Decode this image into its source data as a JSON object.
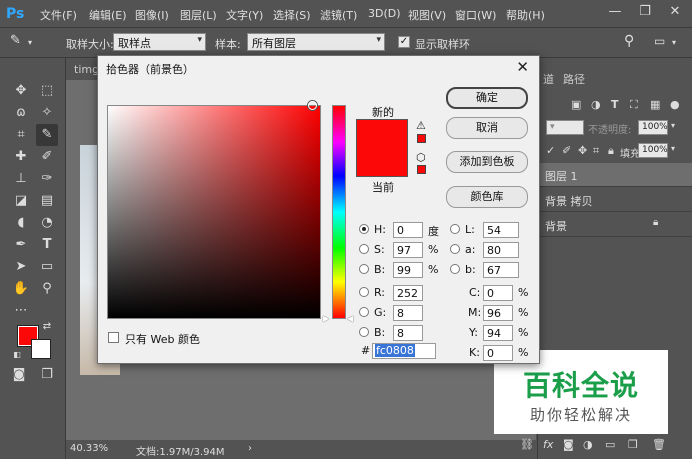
{
  "menubar": {
    "logo": "Ps",
    "items": [
      "文件(F)",
      "编辑(E)",
      "图像(I)",
      "图层(L)",
      "文字(Y)",
      "选择(S)",
      "滤镜(T)",
      "3D(D)",
      "视图(V)",
      "窗口(W)",
      "帮助(H)"
    ],
    "minimize": "—",
    "restore": "❐",
    "close": "✕"
  },
  "options": {
    "sample_size_label": "取样大小:",
    "sample_size_value": "取样点",
    "sample_label": "样本:",
    "sample_value": "所有图层",
    "show_ring_label": "显示取样环"
  },
  "document": {
    "tab_label": "timg",
    "zoom": "40.33%",
    "doc_info": "文档:1.97M/3.94M"
  },
  "right_panel": {
    "tab_channels": "道",
    "tab_paths": "路径",
    "opacity_label": "不透明度:",
    "opacity_value": "100%",
    "fill_label": "填充:",
    "fill_value": "100%",
    "layers": [
      {
        "name": "图层 1",
        "selected": true
      },
      {
        "name": "背景 拷贝",
        "selected": false
      },
      {
        "name": "背景",
        "selected": false
      }
    ]
  },
  "watermark": {
    "title": "百科全说",
    "subtitle": "助你轻松解决"
  },
  "dialog": {
    "title": "拾色器（前景色）",
    "close": "✕",
    "new_label": "新的",
    "current_label": "当前",
    "buttons": {
      "ok": "确定",
      "cancel": "取消",
      "add_swatch": "添加到色板",
      "libraries": "颜色库"
    },
    "web_only_label": "只有 Web 颜色",
    "hsb": {
      "h_label": "H:",
      "h_value": "0",
      "h_unit": "度",
      "s_label": "S:",
      "s_value": "97",
      "s_unit": "%",
      "b_label": "B:",
      "b_value": "99",
      "b_unit": "%"
    },
    "rgb": {
      "r_label": "R:",
      "r_value": "252",
      "g_label": "G:",
      "g_value": "8",
      "b_label": "B:",
      "b_value": "8"
    },
    "lab": {
      "l_label": "L:",
      "l_value": "54",
      "a_label": "a:",
      "a_value": "80",
      "b_label": "b:",
      "b_value": "67"
    },
    "cmyk": {
      "c_label": "C:",
      "c_value": "0",
      "c_unit": "%",
      "m_label": "M:",
      "m_value": "96",
      "m_unit": "%",
      "y_label": "Y:",
      "y_value": "94",
      "y_unit": "%",
      "k_label": "K:",
      "k_value": "0",
      "k_unit": "%"
    },
    "hex_label": "#",
    "hex_value": "fc0808"
  },
  "colors": {
    "foreground": "#fc0808",
    "background": "#ffffff",
    "accent": "#31a8ff"
  }
}
